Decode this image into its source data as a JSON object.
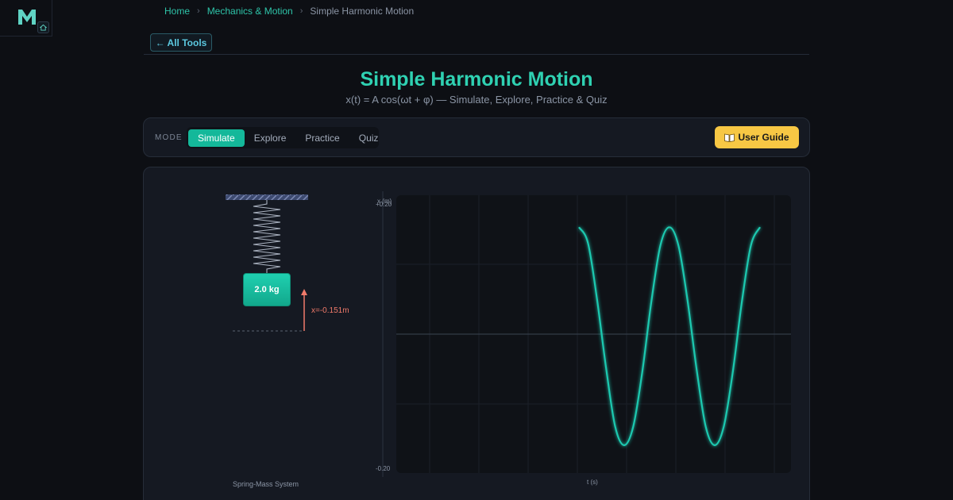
{
  "logo": {
    "letter": "M",
    "icon": "home-icon"
  },
  "breadcrumb": {
    "items": [
      "Home",
      "Mechanics & Motion"
    ],
    "current": "Simple Harmonic Motion",
    "separator": "›"
  },
  "nav": {
    "all_tools": "← All Tools"
  },
  "header": {
    "title": "Simple Harmonic Motion",
    "subtitle": "x(t) = A cos(ωt + φ) — Simulate, Explore, Practice & Quiz"
  },
  "mode": {
    "label": "MODE",
    "tabs": [
      "Simulate",
      "Explore",
      "Practice",
      "Quiz"
    ],
    "active": "Simulate"
  },
  "guide": {
    "label": "User Guide",
    "icon": "book-icon"
  },
  "simulation": {
    "mass_label": "2.0 kg",
    "displacement_label": "x=-0.151m",
    "caption": "Spring-Mass System"
  },
  "colors": {
    "accent": "#2fd1b2",
    "curve": "#1ec9b0",
    "guide": "#f7c744",
    "arrow": "#f07a6a",
    "background": "#0d0f14"
  },
  "chart_data": {
    "type": "line",
    "ylabel": "x (m)",
    "xlabel": "t (s)",
    "y_tick_labels": [
      "+0.20",
      "-0.20"
    ],
    "ylim": [
      -0.2,
      0.2
    ],
    "grid": true,
    "series": [
      {
        "x": [
          0.0,
          0.05,
          0.1,
          0.15,
          0.2,
          0.25,
          0.3,
          0.35,
          0.4,
          0.45,
          0.5,
          0.55,
          0.6,
          0.65,
          0.7,
          0.75,
          0.8,
          0.85,
          0.9,
          0.95,
          1.0
        ],
        "y": [
          0.154,
          0.131,
          0.05,
          -0.049,
          -0.133,
          -0.16,
          -0.133,
          -0.054,
          0.047,
          0.128,
          0.154,
          0.127,
          0.048,
          -0.051,
          -0.133,
          -0.16,
          -0.133,
          -0.054,
          0.047,
          0.128,
          0.154
        ]
      }
    ]
  }
}
